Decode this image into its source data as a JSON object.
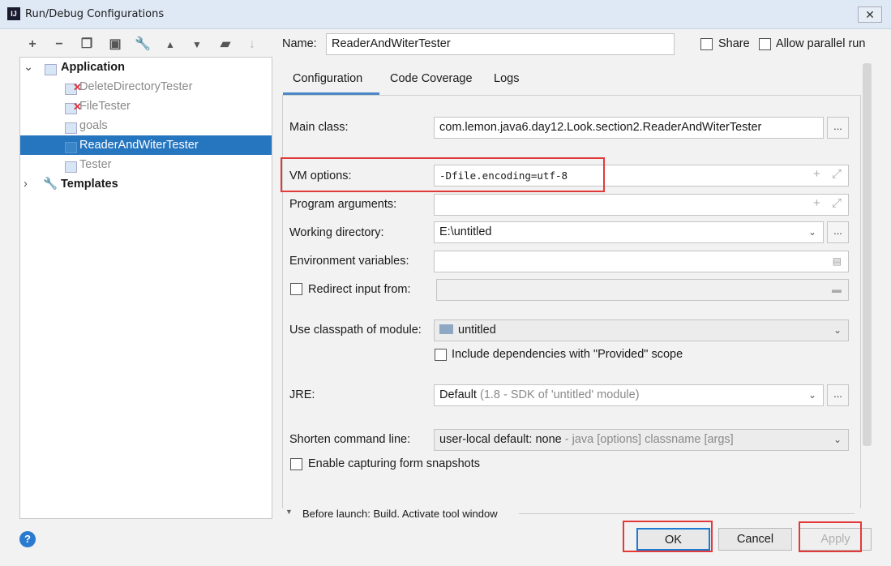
{
  "window": {
    "title": "Run/Debug Configurations",
    "app_icon": "IJ"
  },
  "toolbar": {
    "icons": [
      "plus-icon",
      "minus-icon",
      "copy-icon",
      "save-icon",
      "wrench-icon",
      "move-up-icon",
      "move-down-icon",
      "new-folder-icon",
      "sort-icon"
    ]
  },
  "tree": {
    "application": {
      "label": "Application"
    },
    "items": [
      {
        "label": "DeleteDirectoryTester",
        "error": true
      },
      {
        "label": "FileTester",
        "error": true
      },
      {
        "label": "goals",
        "error": false
      },
      {
        "label": "ReaderAndWiterTester",
        "error": false,
        "selected": true
      },
      {
        "label": "Tester",
        "error": false
      }
    ],
    "templates": {
      "label": "Templates"
    }
  },
  "header": {
    "name_label": "Name:",
    "name_value": "ReaderAndWiterTester",
    "share_label": "Share",
    "share_checked": false,
    "parallel_label": "Allow parallel run",
    "parallel_checked": false
  },
  "tabs": [
    {
      "label": "Configuration",
      "active": true
    },
    {
      "label": "Code Coverage"
    },
    {
      "label": "Logs"
    }
  ],
  "form": {
    "main_class": {
      "label": "Main class:",
      "value": "com.lemon.java6.day12.Look.section2.ReaderAndWiterTester"
    },
    "vm_options": {
      "label": "VM options:",
      "value": "-Dfile.encoding=utf-8"
    },
    "program_arguments": {
      "label": "Program arguments:",
      "value": ""
    },
    "working_directory": {
      "label": "Working directory:",
      "value": "E:\\untitled"
    },
    "environment_variables": {
      "label": "Environment variables:",
      "value": ""
    },
    "redirect_input": {
      "label": "Redirect input from:",
      "checked": false,
      "value": ""
    },
    "classpath_module": {
      "label": "Use classpath of module:",
      "value": "untitled"
    },
    "include_provided": {
      "label": "Include dependencies with \"Provided\" scope",
      "checked": false
    },
    "jre": {
      "label": "JRE:",
      "value": "Default",
      "hint": "(1.8 - SDK of 'untitled' module)"
    },
    "shorten_command_line": {
      "label": "Shorten command line:",
      "value": "user-local default: none",
      "hint": "- java [options] classname [args]"
    },
    "capture_snapshots": {
      "label": "Enable capturing form snapshots",
      "checked": false
    },
    "before_launch": {
      "label": "Before launch: Build, Activate tool window"
    },
    "browse": "..."
  },
  "footer": {
    "help": "?",
    "ok": "OK",
    "cancel": "Cancel",
    "apply": "Apply"
  },
  "colors": {
    "selection": "#2675bf",
    "highlight_box": "#e23a3a",
    "focus": "#1e7ad0"
  }
}
